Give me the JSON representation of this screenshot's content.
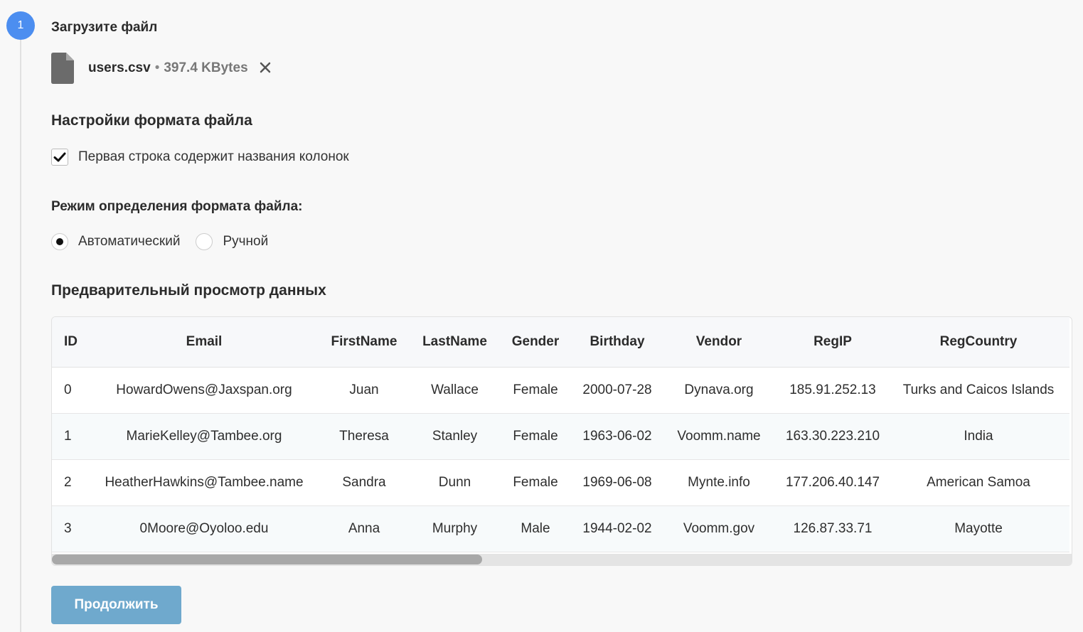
{
  "step": {
    "number": "1",
    "title": "Загрузите файл"
  },
  "file": {
    "name": "users.csv",
    "separator": "•",
    "size": "397.4 KBytes",
    "remove_icon": "close-icon"
  },
  "format_settings": {
    "title": "Настройки формата файла",
    "header_row_label": "Первая строка содержит названия колонок",
    "header_row_checked": true
  },
  "detection_mode": {
    "title": "Режим определения формата файла:",
    "options": [
      {
        "label": "Автоматический",
        "selected": true
      },
      {
        "label": "Ручной",
        "selected": false
      }
    ]
  },
  "preview": {
    "title": "Предварительный просмотр данных",
    "columns": [
      "ID",
      "Email",
      "FirstName",
      "LastName",
      "Gender",
      "Birthday",
      "Vendor",
      "RegIP",
      "RegCountry"
    ],
    "rows": [
      [
        "0",
        "HowardOwens@Jaxspan.org",
        "Juan",
        "Wallace",
        "Female",
        "2000-07-28",
        "Dynava.org",
        "185.91.252.13",
        "Turks and Caicos Islands"
      ],
      [
        "1",
        "MarieKelley@Tambee.org",
        "Theresa",
        "Stanley",
        "Female",
        "1963-06-02",
        "Voomm.name",
        "163.30.223.210",
        "India"
      ],
      [
        "2",
        "HeatherHawkins@Tambee.name",
        "Sandra",
        "Dunn",
        "Female",
        "1969-06-08",
        "Mynte.info",
        "177.206.40.147",
        "American Samoa"
      ],
      [
        "3",
        "0Moore@Oyoloo.edu",
        "Anna",
        "Murphy",
        "Male",
        "1944-02-02",
        "Voomm.gov",
        "126.87.33.71",
        "Mayotte"
      ]
    ],
    "scroll_position": 0.0
  },
  "continue_label": "Продолжить",
  "colors": {
    "step_badge": "#4c8ef0",
    "button": "#6fa9cd"
  }
}
